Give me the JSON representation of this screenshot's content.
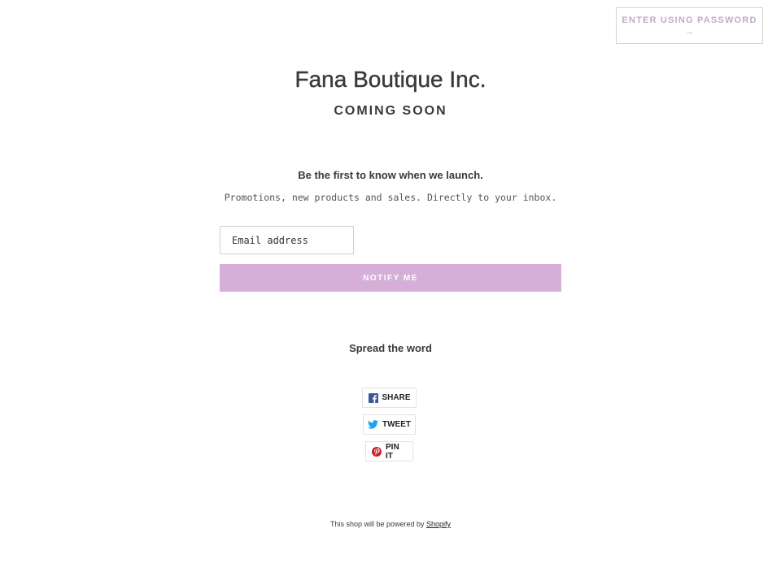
{
  "header": {
    "password_button_label": "ENTER USING PASSWORD",
    "password_button_arrow": "→"
  },
  "hero": {
    "shop_name": "Fana Boutique Inc.",
    "status": "COMING SOON"
  },
  "signup": {
    "heading": "Be the first to know when we launch.",
    "subtext": "Promotions, new products and sales. Directly to your inbox.",
    "email_placeholder": "Email address",
    "submit_label": "NOTIFY ME"
  },
  "share": {
    "heading": "Spread the word",
    "buttons": [
      {
        "label": "SHARE",
        "icon": "facebook-icon"
      },
      {
        "label": "TWEET",
        "icon": "twitter-icon"
      },
      {
        "label": "PIN IT",
        "icon": "pinterest-icon"
      }
    ]
  },
  "footer": {
    "text": "This shop will be powered by",
    "link_label": "Shopify"
  },
  "colors": {
    "accent": "#d6afd9",
    "password_text": "#c9a6cf",
    "facebook": "#3b5998",
    "twitter": "#1da1f2",
    "pinterest": "#cb2027"
  }
}
